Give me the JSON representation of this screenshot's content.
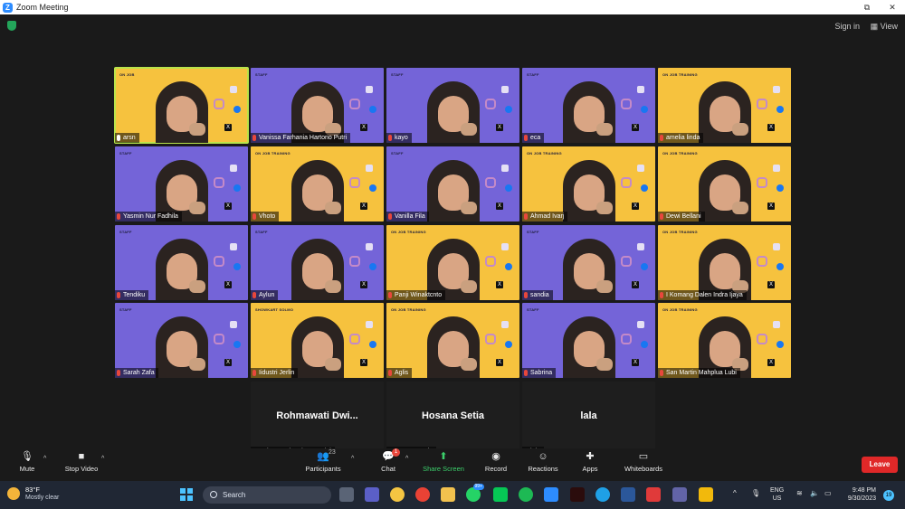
{
  "window": {
    "title": "Zoom Meeting",
    "buttons": [
      "⧉",
      "✕"
    ]
  },
  "meeting_top": {
    "sign_in": "Sign in",
    "view": "View"
  },
  "tiles": [
    {
      "name": "arsn",
      "bg": "yellow",
      "label": "ON JOB",
      "mic": "on",
      "active": true
    },
    {
      "name": "Vanissa Farhania Hartono Putri",
      "bg": "purple",
      "label": "STAFF",
      "mic": "off"
    },
    {
      "name": "kayo",
      "bg": "purple",
      "label": "STAFF",
      "mic": "off"
    },
    {
      "name": "eca",
      "bg": "purple",
      "label": "STAFF",
      "mic": "off"
    },
    {
      "name": "amelia linda",
      "bg": "yellow",
      "label": "ON JOB TRAINING",
      "mic": "off"
    },
    {
      "name": "Yasmin Nur Fadhila",
      "bg": "purple",
      "label": "STAFF",
      "mic": "off"
    },
    {
      "name": "Vhoto",
      "bg": "yellow",
      "label": "ON JOB TRAINING",
      "mic": "off"
    },
    {
      "name": "Vanilla Fila",
      "bg": "purple",
      "label": "STAFF",
      "mic": "off"
    },
    {
      "name": "Ahmad Ivarj",
      "bg": "yellow",
      "label": "ON JOB TRAINING",
      "mic": "off"
    },
    {
      "name": "Dewi Bellani",
      "bg": "yellow",
      "label": "ON JOB TRAINING",
      "mic": "off"
    },
    {
      "name": "Tendiku",
      "bg": "purple",
      "label": "STAFF",
      "mic": "off"
    },
    {
      "name": "Aylun",
      "bg": "purple",
      "label": "STAFF",
      "mic": "off"
    },
    {
      "name": "Panji Winaktcnto",
      "bg": "yellow",
      "label": "ON JOB TRAINING",
      "mic": "off"
    },
    {
      "name": "sandia",
      "bg": "purple",
      "label": "STAFF",
      "mic": "off"
    },
    {
      "name": "I Komang Dalen Indra Ijaya",
      "bg": "yellow",
      "label": "ON JOB TRAINING",
      "mic": "off"
    },
    {
      "name": "Sarah Zafa",
      "bg": "purple",
      "label": "STAFF",
      "mic": "off"
    },
    {
      "name": "Iidustri Jerlin",
      "bg": "yellow",
      "label": "SHOWKART SOLMO",
      "mic": "off"
    },
    {
      "name": "Aglis",
      "bg": "yellow",
      "label": "ON JOB TRAINING",
      "mic": "off"
    },
    {
      "name": "Sabrina",
      "bg": "purple",
      "label": "STAFF",
      "mic": "off"
    },
    {
      "name": "San Martin Mahplua Lubi",
      "bg": "yellow",
      "label": "ON JOB TRAINING",
      "mic": "off"
    },
    {
      "name": "Rohmawati Dwi Anggreini",
      "big": "Rohmawati Dwi...",
      "bg": "black",
      "mic": "off"
    },
    {
      "name": "Hosana Setia",
      "big": "Hosana Setia",
      "bg": "black",
      "mic": "off"
    },
    {
      "name": "lala",
      "big": "lala",
      "bg": "black",
      "mic": "off"
    }
  ],
  "controls": {
    "mute": "Mute",
    "stop_video": "Stop Video",
    "participants": "Participants",
    "participants_count": "23",
    "chat": "Chat",
    "chat_badge": "1",
    "share_screen": "Share Screen",
    "record": "Record",
    "reactions": "Reactions",
    "apps": "Apps",
    "whiteboards": "Whiteboards",
    "leave": "Leave"
  },
  "taskbar": {
    "temp": "83°F",
    "weather": "Mostly clear",
    "search": "Search",
    "whatsapp_badge": "99+",
    "lang_top": "ENG",
    "lang_bottom": "US",
    "time": "9:48 PM",
    "date": "9/30/2023",
    "notif": "19"
  },
  "colors": {
    "purple": "#7464d8",
    "yellow": "#f6c23e",
    "leave": "#e02828",
    "share": "#3ccf6b",
    "active_speaker": "#b9e34a"
  }
}
